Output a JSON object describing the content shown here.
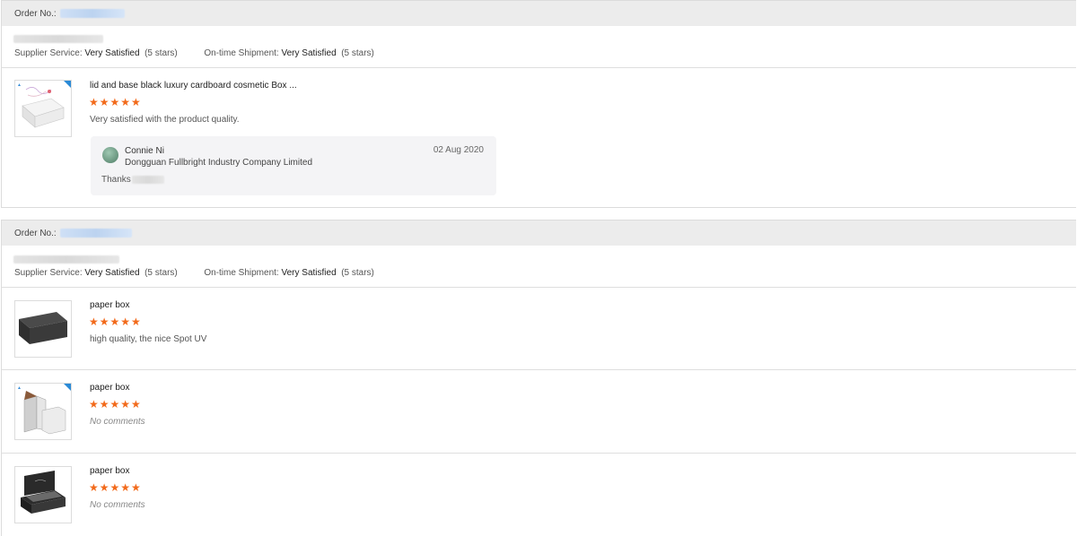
{
  "labels": {
    "order_no": "Order No.:",
    "supplier_service": "Supplier Service:",
    "ontime_shipment": "On-time Shipment:",
    "stars_glyph": "★★★★★"
  },
  "orders": [
    {
      "supplier_service_value": "Very Satisfied",
      "supplier_service_stars": "(5 stars)",
      "ontime_value": "Very Satisfied",
      "ontime_stars": "(5 stars)",
      "products": [
        {
          "title": "lid and base black luxury cardboard cosmetic Box ...",
          "rating": 5,
          "comment": "Very satisfied with the product quality.",
          "reply": {
            "name": "Connie Ni",
            "company": "Dongguan Fullbright Industry Company Limited",
            "date": "02 Aug 2020",
            "text": "Thanks"
          }
        }
      ]
    },
    {
      "supplier_service_value": "Very Satisfied",
      "supplier_service_stars": "(5 stars)",
      "ontime_value": "Very Satisfied",
      "ontime_stars": "(5 stars)",
      "products": [
        {
          "title": "paper box",
          "rating": 5,
          "comment": "high quality, the nice Spot UV"
        },
        {
          "title": "paper box",
          "rating": 5,
          "comment": "No comments"
        },
        {
          "title": "paper box",
          "rating": 5,
          "comment": "No comments"
        }
      ]
    }
  ],
  "colors": {
    "star": "#f26a1b",
    "header_bg": "#ececec",
    "accent_corner": "#2a8ad6"
  }
}
